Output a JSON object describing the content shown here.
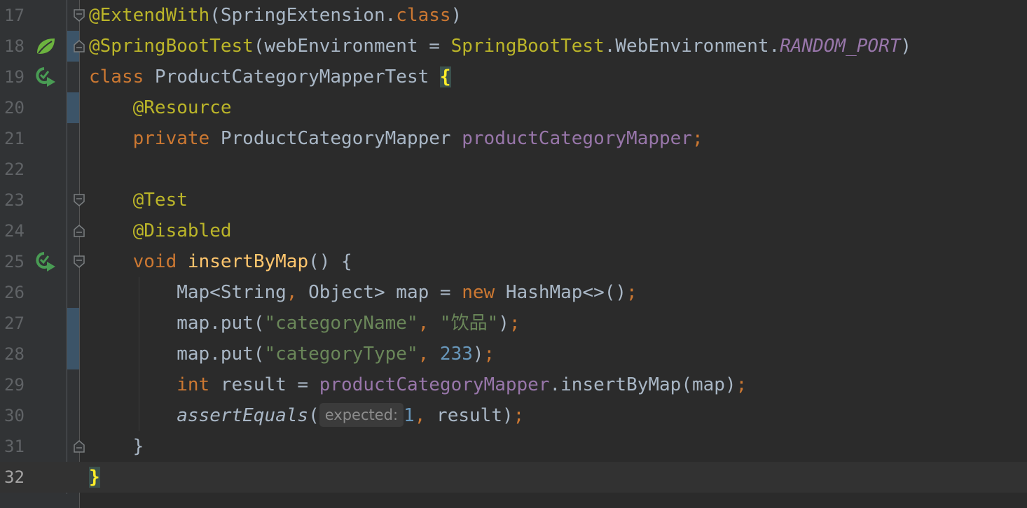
{
  "editor": {
    "lines": [
      {
        "num": "17",
        "tokens": [
          {
            "t": "@ExtendWith",
            "c": "a"
          },
          {
            "t": "(SpringExtension.",
            "c": "t"
          },
          {
            "t": "class",
            "c": "k"
          },
          {
            "t": ")",
            "c": "t"
          }
        ]
      },
      {
        "num": "18",
        "tokens": [
          {
            "t": "@SpringBootTest",
            "c": "a"
          },
          {
            "t": "(webEnvironment = ",
            "c": "t"
          },
          {
            "t": "SpringBootTest",
            "c": "a"
          },
          {
            "t": ".WebEnvironment.",
            "c": "t"
          },
          {
            "t": "RANDOM_PORT",
            "c": "fi"
          },
          {
            "t": ")",
            "c": "t"
          }
        ]
      },
      {
        "num": "19",
        "tokens": [
          {
            "t": "class ",
            "c": "k"
          },
          {
            "t": "ProductCategoryMapperTest ",
            "c": "t"
          },
          {
            "t": "{",
            "c": "brace-hl"
          }
        ]
      },
      {
        "num": "20",
        "tokens": [
          {
            "t": "    ",
            "c": "t"
          },
          {
            "t": "@Resource",
            "c": "a"
          }
        ]
      },
      {
        "num": "21",
        "tokens": [
          {
            "t": "    ",
            "c": "t"
          },
          {
            "t": "private ",
            "c": "k"
          },
          {
            "t": "ProductCategoryMapper ",
            "c": "t"
          },
          {
            "t": "productCategoryMapper",
            "c": "f"
          },
          {
            "t": ";",
            "c": "k"
          }
        ]
      },
      {
        "num": "22",
        "tokens": []
      },
      {
        "num": "23",
        "tokens": [
          {
            "t": "    ",
            "c": "t"
          },
          {
            "t": "@Test",
            "c": "a"
          }
        ]
      },
      {
        "num": "24",
        "tokens": [
          {
            "t": "    ",
            "c": "t"
          },
          {
            "t": "@Disabled",
            "c": "a"
          }
        ]
      },
      {
        "num": "25",
        "tokens": [
          {
            "t": "    ",
            "c": "t"
          },
          {
            "t": "void ",
            "c": "k"
          },
          {
            "t": "insertByMap",
            "c": "m"
          },
          {
            "t": "() {",
            "c": "t"
          }
        ]
      },
      {
        "num": "26",
        "tokens": [
          {
            "t": "        Map<String",
            "c": "t"
          },
          {
            "t": ", ",
            "c": "k"
          },
          {
            "t": "Object> map = ",
            "c": "t"
          },
          {
            "t": "new ",
            "c": "k"
          },
          {
            "t": "HashMap<>()",
            "c": "t"
          },
          {
            "t": ";",
            "c": "k"
          }
        ]
      },
      {
        "num": "27",
        "tokens": [
          {
            "t": "        map.put(",
            "c": "t"
          },
          {
            "t": "\"categoryName\"",
            "c": "s"
          },
          {
            "t": ", ",
            "c": "k"
          },
          {
            "t": "\"饮品\"",
            "c": "s"
          },
          {
            "t": ")",
            "c": "t"
          },
          {
            "t": ";",
            "c": "k"
          }
        ]
      },
      {
        "num": "28",
        "tokens": [
          {
            "t": "        map.put(",
            "c": "t"
          },
          {
            "t": "\"categoryType\"",
            "c": "s"
          },
          {
            "t": ", ",
            "c": "k"
          },
          {
            "t": "233",
            "c": "n"
          },
          {
            "t": ")",
            "c": "t"
          },
          {
            "t": ";",
            "c": "k"
          }
        ]
      },
      {
        "num": "29",
        "tokens": [
          {
            "t": "        ",
            "c": "t"
          },
          {
            "t": "int ",
            "c": "k"
          },
          {
            "t": "result = ",
            "c": "t"
          },
          {
            "t": "productCategoryMapper",
            "c": "f"
          },
          {
            "t": ".insertByMap(map)",
            "c": "t"
          },
          {
            "t": ";",
            "c": "k"
          }
        ]
      },
      {
        "num": "30",
        "tokens": [
          {
            "t": "        ",
            "c": "t"
          },
          {
            "t": "assertEquals",
            "c": "i"
          },
          {
            "t": "(",
            "c": "t"
          },
          {
            "hint": "expected:"
          },
          {
            "t": "1",
            "c": "n"
          },
          {
            "t": ", ",
            "c": "k"
          },
          {
            "t": "result)",
            "c": "t"
          },
          {
            "t": ";",
            "c": "k"
          }
        ]
      },
      {
        "num": "31",
        "tokens": [
          {
            "t": "    }",
            "c": "t"
          }
        ]
      },
      {
        "num": "32",
        "tokens": [
          {
            "t": "}",
            "c": "brace-hl"
          }
        ],
        "current": true
      }
    ]
  },
  "gutter_icons": [
    {
      "line": "18",
      "icon": "spring-bean-icon"
    },
    {
      "line": "19",
      "icon": "run-test-icon"
    },
    {
      "line": "25",
      "icon": "run-test-icon"
    }
  ],
  "fold_markers": [
    {
      "line": "17",
      "kind": "start"
    },
    {
      "line": "18",
      "kind": "end"
    },
    {
      "line": "23",
      "kind": "start"
    },
    {
      "line": "24",
      "kind": "end"
    },
    {
      "line": "25",
      "kind": "start"
    },
    {
      "line": "31",
      "kind": "end"
    }
  ],
  "colors": {
    "background": "#2b2b2b",
    "gutter": "#313335",
    "keyword": "#cc7832",
    "annotation": "#bbb529",
    "string": "#6a8759",
    "number": "#6897bb",
    "field": "#9876aa",
    "method": "#ffc66d",
    "text": "#a9b7c6",
    "run_icon": "#499c54"
  }
}
